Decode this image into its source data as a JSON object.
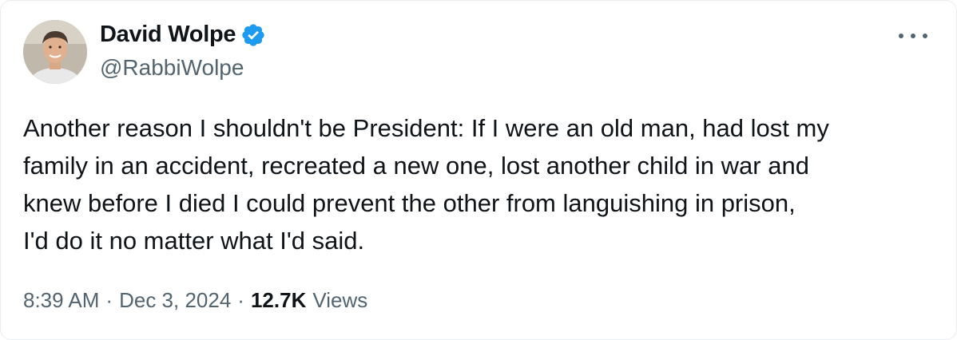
{
  "author": {
    "display_name": "David Wolpe",
    "handle": "@RabbiWolpe",
    "verified": true
  },
  "colors": {
    "text": "#0f1419",
    "secondary": "#536471",
    "verified_badge": "#1d9bf0"
  },
  "icons": {
    "verified": "verified-badge-icon",
    "more": "more-options-icon"
  },
  "tweet": {
    "lines": [
      "Another reason I shouldn't be President: If I were an old man, had lost my",
      "family in an accident, recreated a new one, lost another child in war and",
      "knew before I died I could prevent the other from languishing in prison,",
      "I'd do it no matter what I'd said."
    ]
  },
  "meta": {
    "time": "8:39 AM",
    "separator": "·",
    "date": "Dec 3, 2024",
    "views_count": "12.7K",
    "views_label": "Views"
  }
}
